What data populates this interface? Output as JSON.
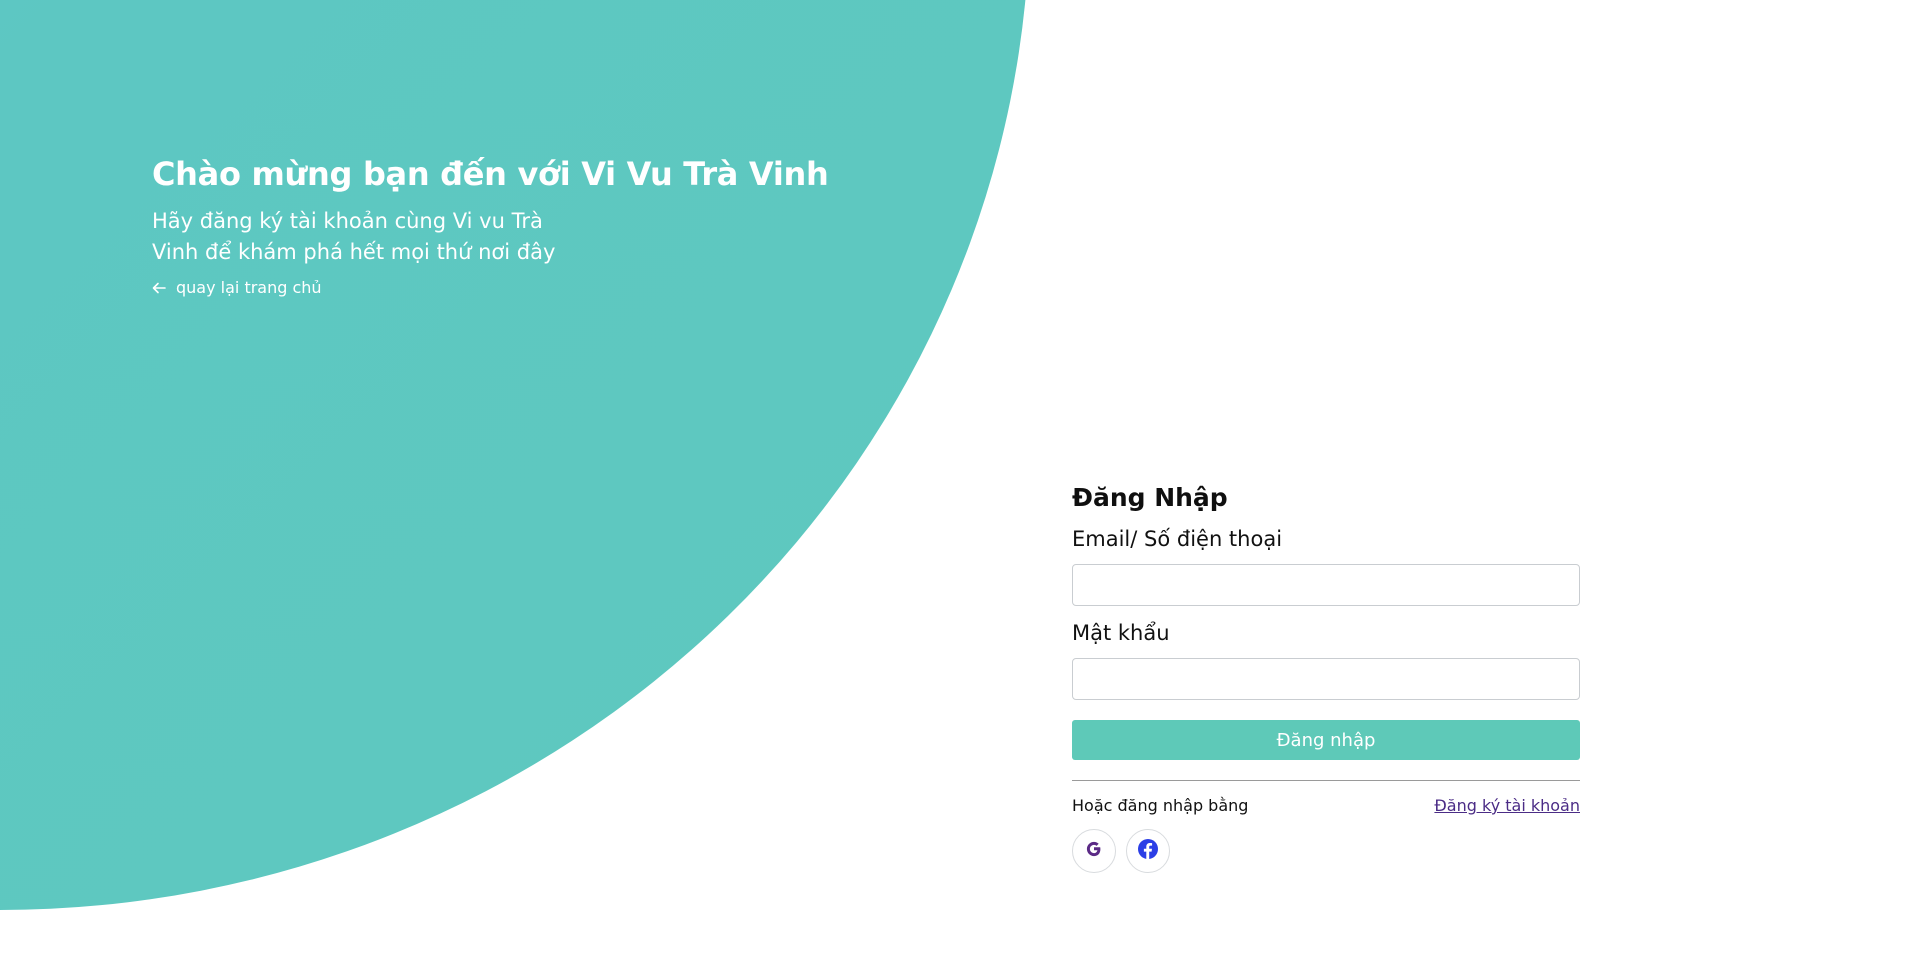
{
  "hero": {
    "title": "Chào mừng bạn đến với Vi Vu Trà Vinh",
    "subtitle": "Hãy đăng ký tài khoản cùng Vi vu Trà Vinh để khám phá hết mọi thứ nơi đây",
    "back_link": "quay lại trang chủ",
    "back_icon": "arrow-left-icon"
  },
  "login": {
    "title": "Đăng Nhập",
    "email_label": "Email/ Số điện thoại",
    "email_value": "",
    "password_label": "Mật khẩu",
    "password_value": "",
    "submit_label": "Đăng nhập",
    "alt_login_text": "Hoặc đăng nhập bằng",
    "register_link": "Đăng ký tài khoản",
    "social": [
      {
        "icon": "google-icon",
        "color": "#5b2a86"
      },
      {
        "icon": "facebook-icon",
        "color": "#2b3ee6"
      }
    ]
  },
  "colors": {
    "hero_gradient_start": "#5bc3d6",
    "hero_gradient_end": "#5ec9be",
    "button": "#5ec9b8",
    "link": "#4b2c86"
  }
}
